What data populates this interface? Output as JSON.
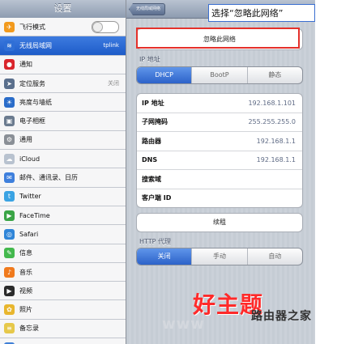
{
  "sidebar": {
    "title": "设置",
    "items": [
      {
        "label": "飞行模式",
        "icon": "airplane-icon",
        "color": "#f29a1d",
        "glyph": "✈",
        "type": "toggle"
      },
      {
        "label": "无线局域网",
        "icon": "wifi-icon",
        "color": "#2f6fd6",
        "glyph": "≋",
        "value": "tplink",
        "active": true
      },
      {
        "label": "通知",
        "icon": "notifications-icon",
        "color": "#d9252c",
        "glyph": "●"
      },
      {
        "label": "定位服务",
        "icon": "location-icon",
        "color": "#5a6f8c",
        "glyph": "➤",
        "value": "关闭"
      },
      {
        "label": "亮度与墙纸",
        "icon": "brightness-icon",
        "color": "#2a6cc9",
        "glyph": "☀"
      },
      {
        "label": "电子相框",
        "icon": "picture-frame-icon",
        "color": "#6b7b8f",
        "glyph": "▣"
      },
      {
        "label": "通用",
        "icon": "gear-icon",
        "color": "#8a8f96",
        "glyph": "⚙"
      },
      {
        "label": "iCloud",
        "icon": "cloud-icon",
        "color": "#b8c2cf",
        "glyph": "☁"
      },
      {
        "label": "邮件、通讯录、日历",
        "icon": "mail-icon",
        "color": "#3e7fdc",
        "glyph": "✉"
      },
      {
        "label": "Twitter",
        "icon": "twitter-icon",
        "color": "#3aa3e3",
        "glyph": "t"
      },
      {
        "label": "FaceTime",
        "icon": "facetime-icon",
        "color": "#3aa446",
        "glyph": "▶"
      },
      {
        "label": "Safari",
        "icon": "safari-icon",
        "color": "#2f85d8",
        "glyph": "◎"
      },
      {
        "label": "信息",
        "icon": "messages-icon",
        "color": "#43b84d",
        "glyph": "✎"
      },
      {
        "label": "音乐",
        "icon": "music-icon",
        "color": "#f07a1d",
        "glyph": "♪"
      },
      {
        "label": "视频",
        "icon": "video-icon",
        "color": "#2b2b2b",
        "glyph": "▶"
      },
      {
        "label": "照片",
        "icon": "photos-icon",
        "color": "#e8b62e",
        "glyph": "✿"
      },
      {
        "label": "备忘录",
        "icon": "notes-icon",
        "color": "#e6c84a",
        "glyph": "≡"
      },
      {
        "label": "Store",
        "icon": "store-icon",
        "color": "#3f7fd6",
        "glyph": "A"
      }
    ]
  },
  "detail": {
    "back_label": "无线局域网络",
    "forget_label": "忽略此网络",
    "ip_section": "IP 地址",
    "ip_modes": [
      {
        "label": "DHCP",
        "selected": true
      },
      {
        "label": "BootP",
        "selected": false
      },
      {
        "label": "静态",
        "selected": false
      }
    ],
    "info_rows": [
      {
        "key": "IP 地址",
        "value": "192.168.1.101"
      },
      {
        "key": "子网掩码",
        "value": "255.255.255.0"
      },
      {
        "key": "路由器",
        "value": "192.168.1.1"
      },
      {
        "key": "DNS",
        "value": "192.168.1.1"
      },
      {
        "key": "搜索域",
        "value": ""
      },
      {
        "key": "客户端 ID",
        "value": ""
      }
    ],
    "renew_label": "续租",
    "proxy_section": "HTTP 代理",
    "proxy_modes": [
      {
        "label": "关闭",
        "selected": true
      },
      {
        "label": "手动",
        "selected": false
      },
      {
        "label": "自动",
        "selected": false
      }
    ]
  },
  "annotation": {
    "callout_text": "选择“忽略此网络”",
    "highlight_color": "#e4312b"
  },
  "watermark": {
    "brand": "好主题",
    "site_partial": "www",
    "subtitle": "路由器之家"
  }
}
